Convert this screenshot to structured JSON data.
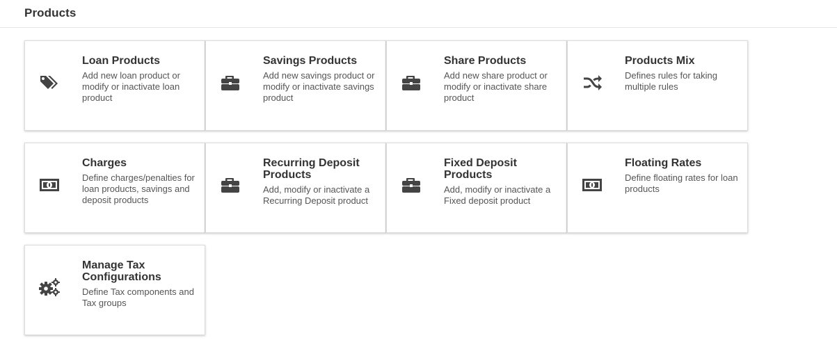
{
  "page": {
    "title": "Products"
  },
  "cards": [
    {
      "title": "Loan Products",
      "description": "Add new loan product or modify or inactivate loan product",
      "icon": "tags-icon"
    },
    {
      "title": "Savings Products",
      "description": "Add new savings product or modify or inactivate savings product",
      "icon": "briefcase-icon"
    },
    {
      "title": "Share Products",
      "description": "Add new share product or modify or inactivate share product",
      "icon": "briefcase-icon"
    },
    {
      "title": "Products Mix",
      "description": "Defines rules for taking multiple rules",
      "icon": "random-icon"
    },
    {
      "title": "Charges",
      "description": "Define charges/penalties for loan products, savings and deposit products",
      "icon": "money-icon"
    },
    {
      "title": "Recurring Deposit Products",
      "description": "Add, modify or inactivate a Recurring Deposit product",
      "icon": "briefcase-icon"
    },
    {
      "title": "Fixed Deposit Products",
      "description": "Add, modify or inactivate a Fixed deposit product",
      "icon": "briefcase-icon"
    },
    {
      "title": "Floating Rates",
      "description": "Define floating rates for loan products",
      "icon": "money-icon"
    },
    {
      "title": "Manage Tax Configurations",
      "description": "Define Tax components and Tax groups",
      "icon": "cogs-icon"
    }
  ],
  "colors": {
    "icon": "#444444",
    "title": "#333333",
    "description": "#555555"
  }
}
